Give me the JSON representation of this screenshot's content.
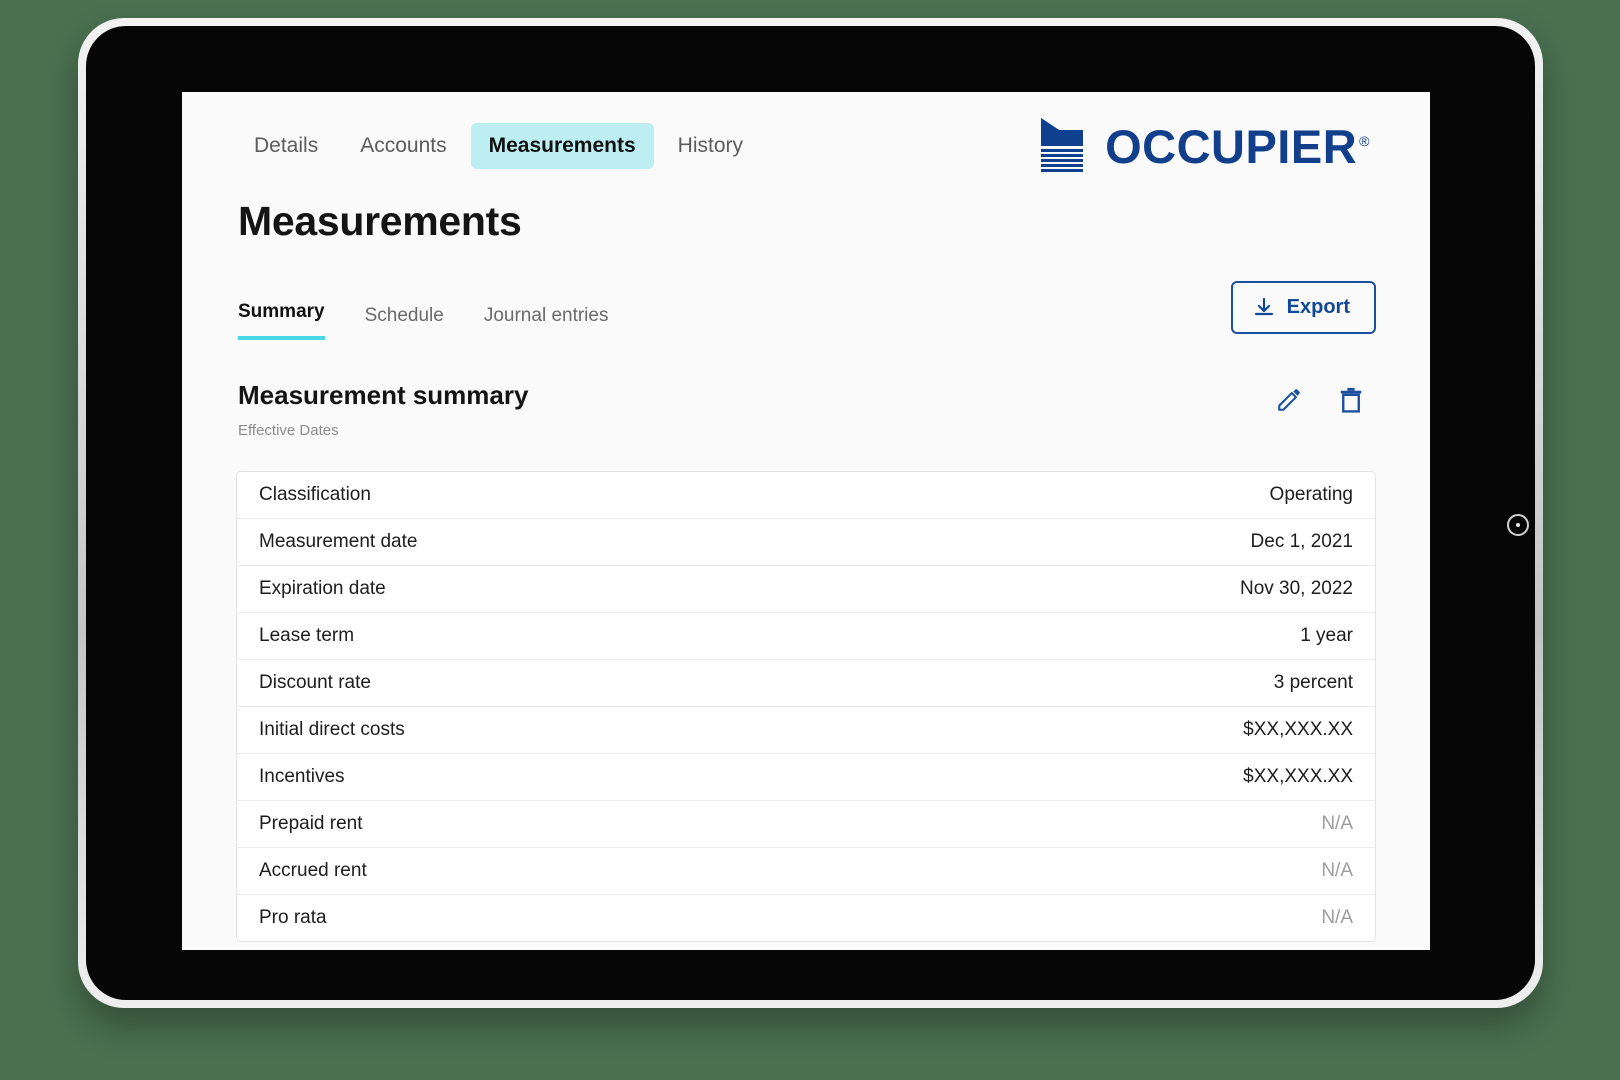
{
  "brand": {
    "name": "OCCUPIER",
    "trademark": "®",
    "color": "#113f8c"
  },
  "top_tabs": [
    {
      "label": "Details",
      "active": false
    },
    {
      "label": "Accounts",
      "active": false
    },
    {
      "label": "Measurements",
      "active": true
    },
    {
      "label": "History",
      "active": false
    }
  ],
  "page": {
    "title": "Measurements"
  },
  "sub_tabs": [
    {
      "label": "Summary",
      "active": true
    },
    {
      "label": "Schedule",
      "active": false
    },
    {
      "label": "Journal entries",
      "active": false
    }
  ],
  "toolbar": {
    "export_label": "Export",
    "export_icon": "download-icon",
    "accent_color": "#114996",
    "active_underline_color": "#45d8e4",
    "active_tab_bg": "#bdeef2"
  },
  "summary": {
    "heading": "Measurement summary",
    "subheading": "Effective Dates",
    "edit_icon": "pencil-icon",
    "delete_icon": "trash-icon"
  },
  "table": {
    "rows": [
      {
        "label": "Classification",
        "value": "Operating",
        "muted": false
      },
      {
        "label": "Measurement date",
        "value": "Dec 1, 2021",
        "muted": false
      },
      {
        "label": "Expiration date",
        "value": "Nov 30, 2022",
        "muted": false
      },
      {
        "label": "Lease term",
        "value": "1 year",
        "muted": false
      },
      {
        "label": "Discount rate",
        "value": "3 percent",
        "muted": false
      },
      {
        "label": "Initial direct costs",
        "value": "$XX,XXX.XX",
        "muted": false
      },
      {
        "label": "Incentives",
        "value": "$XX,XXX.XX",
        "muted": false
      },
      {
        "label": "Prepaid rent",
        "value": "N/A",
        "muted": true
      },
      {
        "label": "Accrued rent",
        "value": "N/A",
        "muted": true
      },
      {
        "label": "Pro rata",
        "value": "N/A",
        "muted": true
      }
    ]
  },
  "device": {
    "nav_up_icon": "chevron-up-icon",
    "nav_home_icon": "square-home-icon",
    "nav_down_icon": "chevron-down-icon",
    "camera_icon": "camera-lens-icon"
  }
}
